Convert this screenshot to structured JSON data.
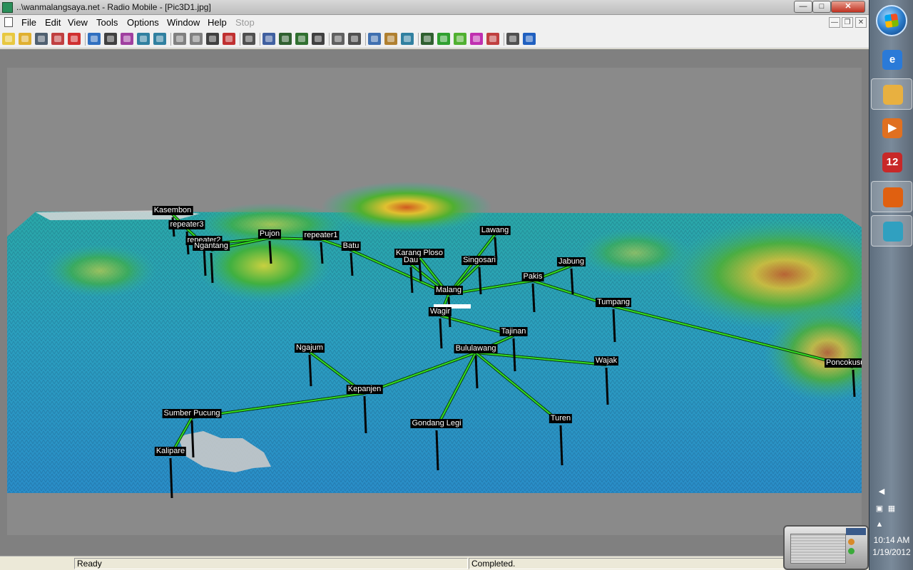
{
  "window": {
    "title": "..\\wanmalangsaya.net - Radio Mobile - [Pic3D1.jpg]"
  },
  "menu": [
    {
      "label": "File",
      "disabled": false
    },
    {
      "label": "Edit",
      "disabled": false
    },
    {
      "label": "View",
      "disabled": false
    },
    {
      "label": "Tools",
      "disabled": false
    },
    {
      "label": "Options",
      "disabled": false
    },
    {
      "label": "Window",
      "disabled": false
    },
    {
      "label": "Help",
      "disabled": false
    },
    {
      "label": "Stop",
      "disabled": true
    }
  ],
  "toolbar": {
    "buttons": [
      {
        "icon": "new-file-icon",
        "color": "#e8c840"
      },
      {
        "icon": "open-folder-icon",
        "color": "#e0b030"
      },
      {
        "icon": "network-properties-icon",
        "color": "#506070"
      },
      {
        "icon": "unit-properties-icon",
        "color": "#c04040"
      },
      {
        "icon": "link-icon",
        "color": "#d03030"
      },
      {
        "icon": "globe-icon",
        "color": "#3070c0"
      },
      {
        "icon": "save-picture-icon",
        "color": "#404040"
      },
      {
        "icon": "world-map-icon",
        "color": "#a040a0"
      },
      {
        "icon": "import-icon",
        "color": "#3080a0"
      },
      {
        "icon": "export-icon",
        "color": "#3080a0"
      },
      {
        "icon": "new-picture-icon",
        "color": "#808080"
      },
      {
        "icon": "open-picture-icon",
        "color": "#808080"
      },
      {
        "icon": "save-image-icon",
        "color": "#404040"
      },
      {
        "icon": "pdf-icon",
        "color": "#c03030"
      },
      {
        "icon": "print-icon",
        "color": "#505050"
      },
      {
        "icon": "copy-icon",
        "color": "#4060a0"
      },
      {
        "icon": "merge-pictures-icon",
        "color": "#306030"
      },
      {
        "icon": "elevation-icon",
        "color": "#307030"
      },
      {
        "icon": "color-scale-icon",
        "color": "#404040"
      },
      {
        "icon": "grid-icon",
        "color": "#606060"
      },
      {
        "icon": "compass-icon",
        "color": "#505050"
      },
      {
        "icon": "window-icon",
        "color": "#4070b0"
      },
      {
        "icon": "find-best-site-icon",
        "color": "#b08030"
      },
      {
        "icon": "fit-icon",
        "color": "#3080a0"
      },
      {
        "icon": "antenna-icon",
        "color": "#306030"
      },
      {
        "icon": "radio-coverage-icon",
        "color": "#30a030"
      },
      {
        "icon": "combined-coverage-icon",
        "color": "#50b030"
      },
      {
        "icon": "interference-icon",
        "color": "#c030b0"
      },
      {
        "icon": "route-coverage-icon",
        "color": "#c04040"
      },
      {
        "icon": "settings-icon",
        "color": "#505050"
      },
      {
        "icon": "internet-icon",
        "color": "#2060c0"
      }
    ]
  },
  "scene": {
    "sites": [
      {
        "label": "Kasembon"
      },
      {
        "label": "repeater3"
      },
      {
        "label": "repeater2"
      },
      {
        "label": "Ngantang"
      },
      {
        "label": "Pujon"
      },
      {
        "label": "repeater1"
      },
      {
        "label": "Batu"
      },
      {
        "label": "Karang Ploso"
      },
      {
        "label": "Dau"
      },
      {
        "label": "Lawang"
      },
      {
        "label": "Singosari"
      },
      {
        "label": "Jabung"
      },
      {
        "label": "Pakis"
      },
      {
        "label": "Malang"
      },
      {
        "label": "Tumpang"
      },
      {
        "label": "Wagir"
      },
      {
        "label": "Tajinan"
      },
      {
        "label": "Bululawang"
      },
      {
        "label": "Ngajum"
      },
      {
        "label": "Wajak"
      },
      {
        "label": "Poncokusumo"
      },
      {
        "label": "Kepanjen"
      },
      {
        "label": "Sumber Pucung"
      },
      {
        "label": "Gondang Legi"
      },
      {
        "label": "Turen"
      },
      {
        "label": "Kalipare"
      }
    ],
    "link_color": "#33dd22"
  },
  "status": {
    "left": "Ready",
    "right": "Completed."
  },
  "taskbar": {
    "apps": [
      {
        "icon": "internet-explorer-icon",
        "glyph": "e",
        "color": "#2a7ad8",
        "active": false
      },
      {
        "icon": "file-explorer-icon",
        "glyph": "",
        "color": "#e8b040",
        "active": true
      },
      {
        "icon": "media-player-icon",
        "glyph": "▶",
        "color": "#e07020",
        "active": false
      },
      {
        "icon": "video-editor-icon",
        "glyph": "12",
        "color": "#c82828",
        "active": false
      },
      {
        "icon": "firefox-icon",
        "glyph": "",
        "color": "#e06010",
        "active": true
      },
      {
        "icon": "radio-mobile-icon",
        "glyph": "",
        "color": "#30a0c0",
        "active": true
      }
    ],
    "clock": {
      "time": "10:14 AM",
      "date": "1/19/2012"
    }
  }
}
